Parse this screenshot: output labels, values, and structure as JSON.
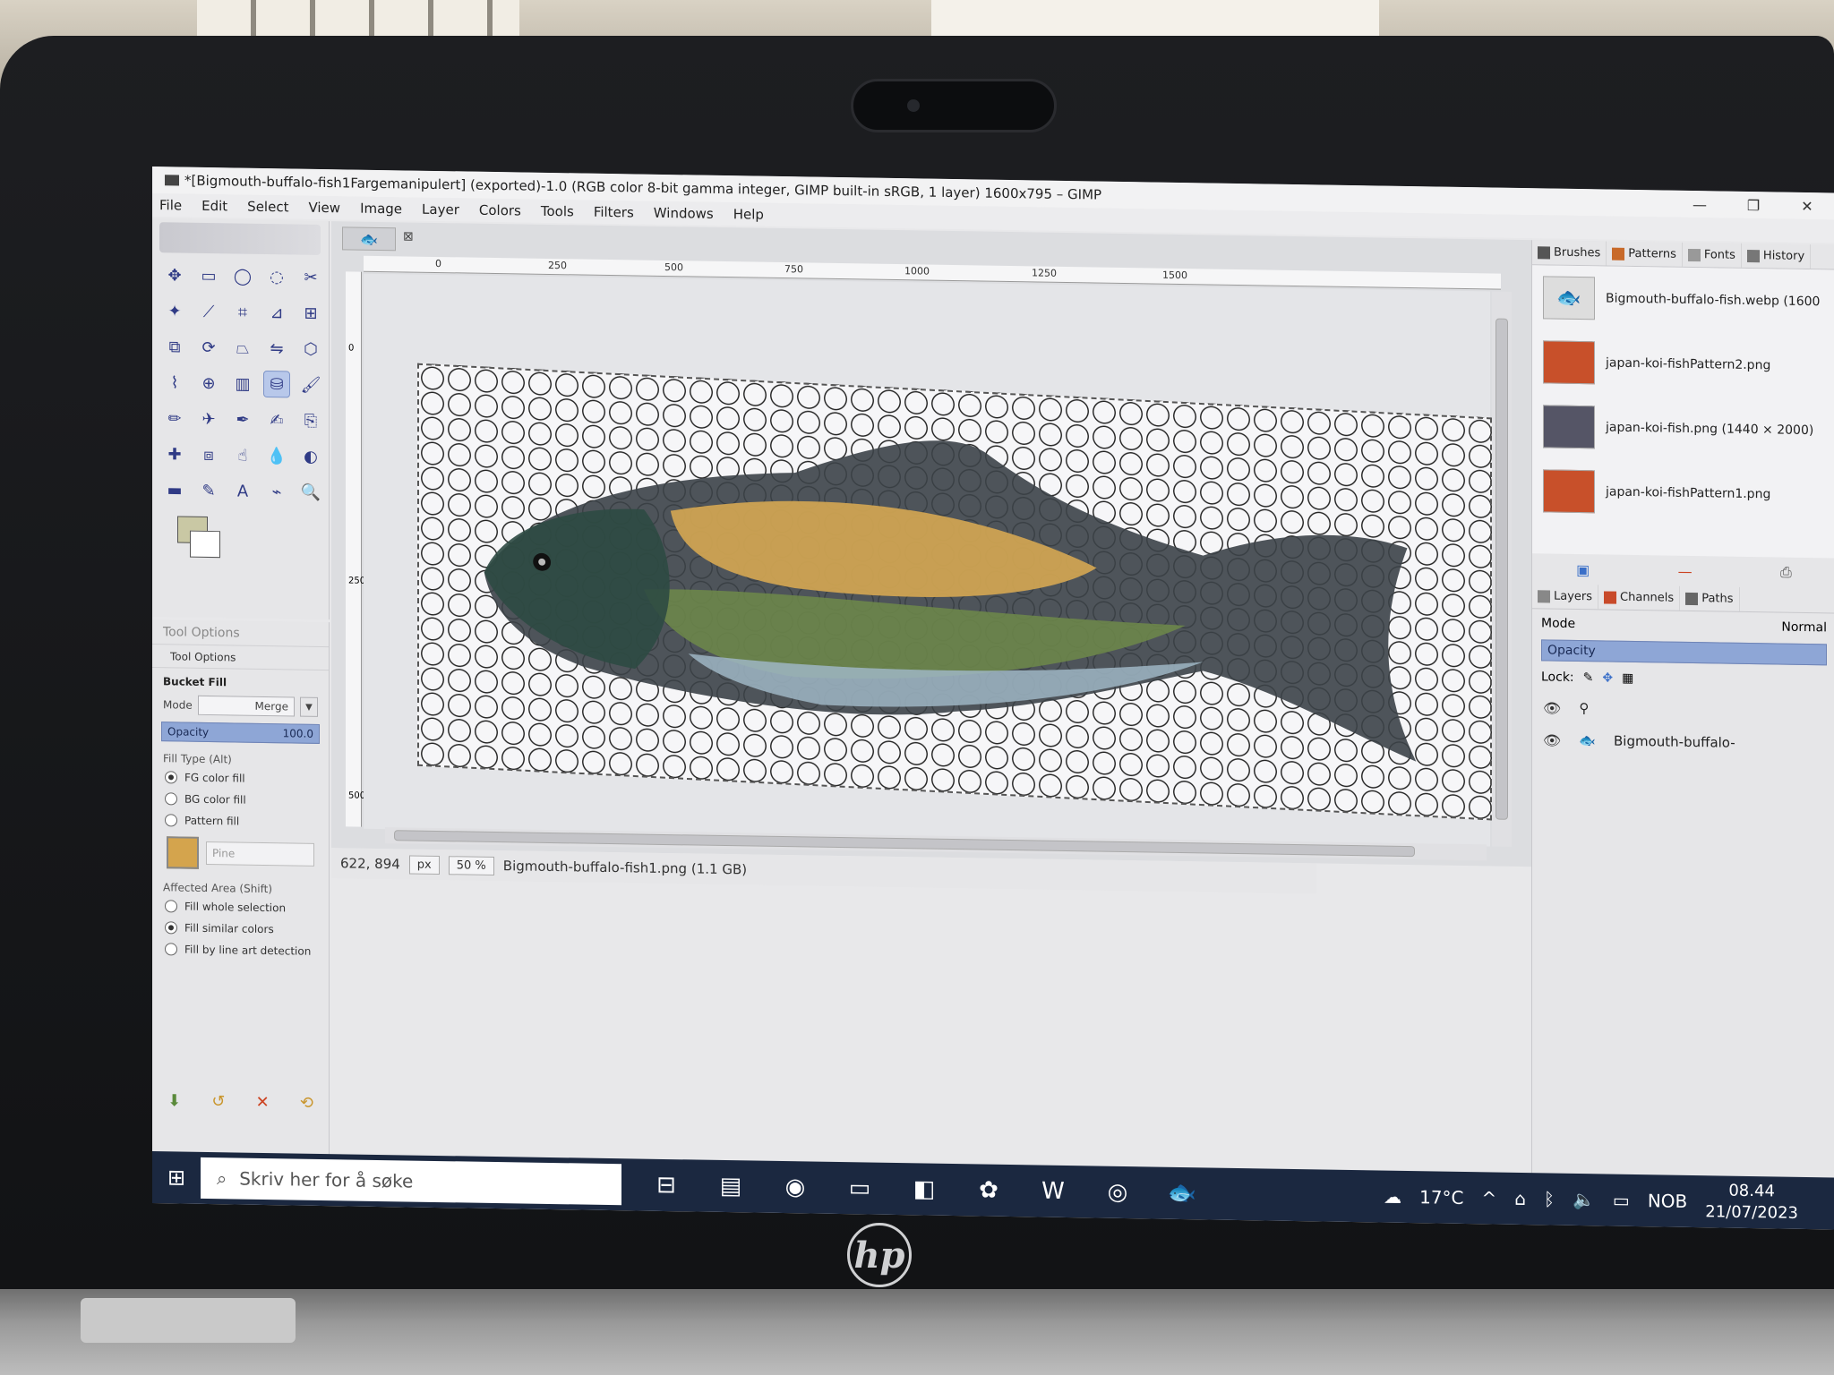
{
  "window": {
    "title": "*[Bigmouth-buffalo-fish1Fargemanipulert] (exported)-1.0 (RGB color 8-bit gamma integer, GIMP built-in sRGB, 1 layer) 1600x795 – GIMP"
  },
  "menubar": [
    "File",
    "Edit",
    "Select",
    "View",
    "Image",
    "Layer",
    "Colors",
    "Tools",
    "Filters",
    "Windows",
    "Help"
  ],
  "toolbox": {
    "tools": [
      "move-icon",
      "rect-select-icon",
      "ellipse-select-icon",
      "lasso-icon",
      "scissors-icon",
      "fuzzy-select-icon",
      "knife-icon",
      "crop-icon",
      "measure-icon",
      "align-icon",
      "unified-transform-icon",
      "rotate-icon",
      "perspective-icon",
      "flip-icon",
      "cage-icon",
      "warp-icon",
      "handle-transform-icon",
      "gradient-icon",
      "bucket-fill-icon",
      "paintbrush-icon",
      "pencil-icon",
      "airbrush-icon",
      "ink-icon",
      "mypaint-icon",
      "clone-icon",
      "heal-icon",
      "perspective-clone-icon",
      "smudge-icon",
      "blur-icon",
      "dodge-icon",
      "eraser-icon",
      "paths-icon",
      "text-icon",
      "color-picker-icon",
      "zoom-icon"
    ],
    "fg_color": "#c9c8a4",
    "bg_color": "#ffffff"
  },
  "tool_options": {
    "header": "Tool Options",
    "tab": "Tool Options",
    "title": "Bucket Fill",
    "mode_label": "Mode",
    "mode_value": "Merge",
    "opacity_label": "Opacity",
    "opacity_value": "100.0",
    "fill_type_label": "Fill Type  (Alt)",
    "fill_types": [
      "FG color fill",
      "BG color fill",
      "Pattern fill"
    ],
    "pattern_name": "Pine",
    "affected_area_label": "Affected Area  (Shift)",
    "affected_areas": [
      "Fill whole selection",
      "Fill similar colors",
      "Fill by line art detection"
    ]
  },
  "ruler": {
    "top_marks": [
      "0",
      "250",
      "500",
      "750",
      "1000",
      "1250",
      "1500"
    ],
    "left_marks": [
      "0",
      "250",
      "500"
    ]
  },
  "statusbar": {
    "coords": "622, 894",
    "unit": "px",
    "zoom": "50 %",
    "file": "Bigmouth-buffalo-fish1.png (1.1 GB)"
  },
  "dock_top": {
    "tabs": [
      "Brushes",
      "Patterns",
      "Fonts",
      "History"
    ],
    "images": [
      "Bigmouth-buffalo-fish.webp (1600",
      "japan-koi-fishPattern2.png",
      "japan-koi-fish.png (1440 × 2000)",
      "japan-koi-fishPattern1.png"
    ]
  },
  "layers": {
    "tabs": [
      "Layers",
      "Channels",
      "Paths"
    ],
    "mode_label": "Mode",
    "mode_value": "Normal",
    "opacity_label": "Opacity",
    "lock_label": "Lock:",
    "layer_name": "Bigmouth-buffalo-"
  },
  "taskbar": {
    "search_placeholder": "Skriv her for å søke",
    "temperature": "17°C",
    "language": "NOB",
    "time": "08.44",
    "date": "21/07/2023"
  }
}
